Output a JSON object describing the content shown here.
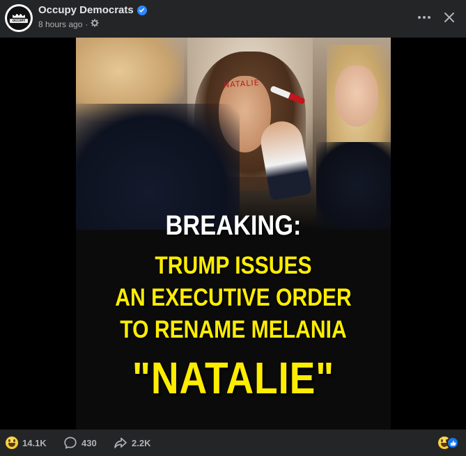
{
  "post": {
    "page_name": "Occupy Democrats",
    "verified": true,
    "timestamp": "8 hours ago",
    "privacy_icon": "gear-icon",
    "avatar_text": "OCCUPY DEMOCRATS"
  },
  "header_actions": {
    "more_icon": "more-horizontal-icon",
    "close_icon": "close-icon"
  },
  "image": {
    "forehead_text": "NATALIE",
    "headline_breaking": "BREAKING:",
    "headline_line1": "TRUMP ISSUES",
    "headline_line2": "AN EXECUTIVE ORDER",
    "headline_line3": "TO RENAME MELANIA",
    "headline_name": "\"NATALIE\""
  },
  "footer": {
    "reactions_count": "14.1K",
    "comments_count": "430",
    "shares_count": "2.2K",
    "reaction_icons": [
      "haha-emoji-icon",
      "like-icon"
    ]
  },
  "colors": {
    "background": "#242526",
    "headline_yellow": "#ffed00",
    "verified_blue": "#2d88ff",
    "like_blue": "#1877f2"
  }
}
